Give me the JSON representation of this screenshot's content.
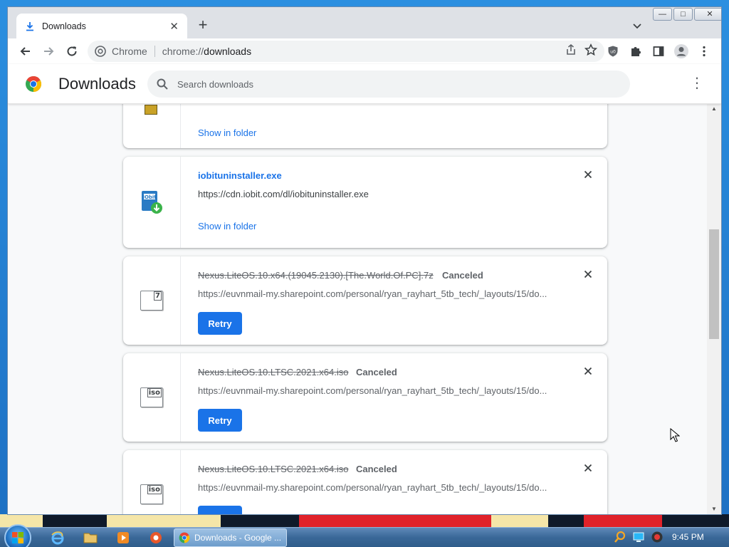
{
  "browser": {
    "tab": {
      "title": "Downloads",
      "close": "✕"
    },
    "new_tab": "+",
    "omnibox": {
      "site_label": "Chrome",
      "url_scheme": "chrome://",
      "url_path": "downloads"
    },
    "window_controls": {
      "minimize": "—",
      "maximize": "□",
      "close": "✕"
    }
  },
  "downloads_page": {
    "title": "Downloads",
    "search_placeholder": "Search downloads",
    "menu_glyph": "⋮"
  },
  "items": [
    {
      "show_in_folder": "Show in folder"
    },
    {
      "filename": "iobituninstaller.exe",
      "url": "https://cdn.iobit.com/dl/iobituninstaller.exe",
      "show_in_folder": "Show in folder"
    },
    {
      "filename": "Nexus.LiteOS.10.x64.(19045.2130).[The.World.Of.PC].7z",
      "status": "Canceled",
      "url": "https://euvnmail-my.sharepoint.com/personal/ryan_rayhart_5tb_tech/_layouts/15/do...",
      "retry": "Retry",
      "icon_label": "7"
    },
    {
      "filename": "Nexus.LiteOS.10.LTSC.2021.x64.iso",
      "status": "Canceled",
      "url": "https://euvnmail-my.sharepoint.com/personal/ryan_rayhart_5tb_tech/_layouts/15/do...",
      "retry": "Retry",
      "icon_label": "iso"
    },
    {
      "filename": "Nexus.LiteOS.10.LTSC.2021.x64.iso",
      "status": "Canceled",
      "url": "https://euvnmail-my.sharepoint.com/personal/ryan_rayhart_5tb_tech/_layouts/15/do...",
      "retry": "Retry",
      "icon_label": "iso"
    }
  ],
  "taskbar": {
    "active_task": "Downloads - Google ...",
    "clock": "9:45 PM"
  },
  "colors": {
    "accent": "#1a73e8",
    "taskbar": "#3a6898"
  }
}
